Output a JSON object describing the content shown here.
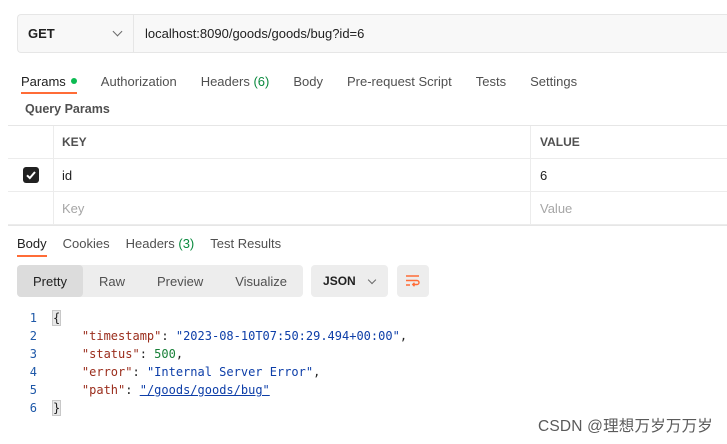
{
  "request": {
    "method": "GET",
    "url": "localhost:8090/goods/goods/bug?id=6"
  },
  "request_tabs": [
    {
      "label": "Params",
      "suffix": "",
      "active": true
    },
    {
      "label": "Authorization",
      "suffix": ""
    },
    {
      "label": "Headers",
      "suffix": "(6)"
    },
    {
      "label": "Body",
      "suffix": ""
    },
    {
      "label": "Pre-request Script",
      "suffix": ""
    },
    {
      "label": "Tests",
      "suffix": ""
    },
    {
      "label": "Settings",
      "suffix": ""
    }
  ],
  "query_params": {
    "title": "Query Params",
    "columns": {
      "key": "KEY",
      "value": "VALUE"
    },
    "rows": [
      {
        "checked": true,
        "key": "id",
        "value": "6"
      }
    ],
    "placeholder": {
      "key": "Key",
      "value": "Value"
    }
  },
  "response_tabs": [
    {
      "label": "Body",
      "active": true
    },
    {
      "label": "Cookies"
    },
    {
      "label": "Headers",
      "count": "(3)"
    },
    {
      "label": "Test Results"
    }
  ],
  "view_modes": [
    "Pretty",
    "Raw",
    "Preview",
    "Visualize"
  ],
  "active_view_mode": "Pretty",
  "format": "JSON",
  "response_body": {
    "line_numbers": [
      "1",
      "2",
      "3",
      "4",
      "5",
      "6"
    ],
    "open_brace": "{",
    "close_brace": "}",
    "fields": [
      {
        "key": "\"timestamp\"",
        "value": "\"2023-08-10T07:50:29.494+00:00\"",
        "type": "string",
        "trail": ","
      },
      {
        "key": "\"status\"",
        "value": "500",
        "type": "number",
        "trail": ","
      },
      {
        "key": "\"error\"",
        "value": "\"Internal Server Error\"",
        "type": "string",
        "trail": ","
      },
      {
        "key": "\"path\"",
        "value": "\"/goods/goods/bug\"",
        "type": "link",
        "trail": ""
      }
    ]
  },
  "watermark": "CSDN @理想万岁万万岁",
  "colors": {
    "accent": "#ff6c37",
    "params_dot": "#0cbb52"
  }
}
